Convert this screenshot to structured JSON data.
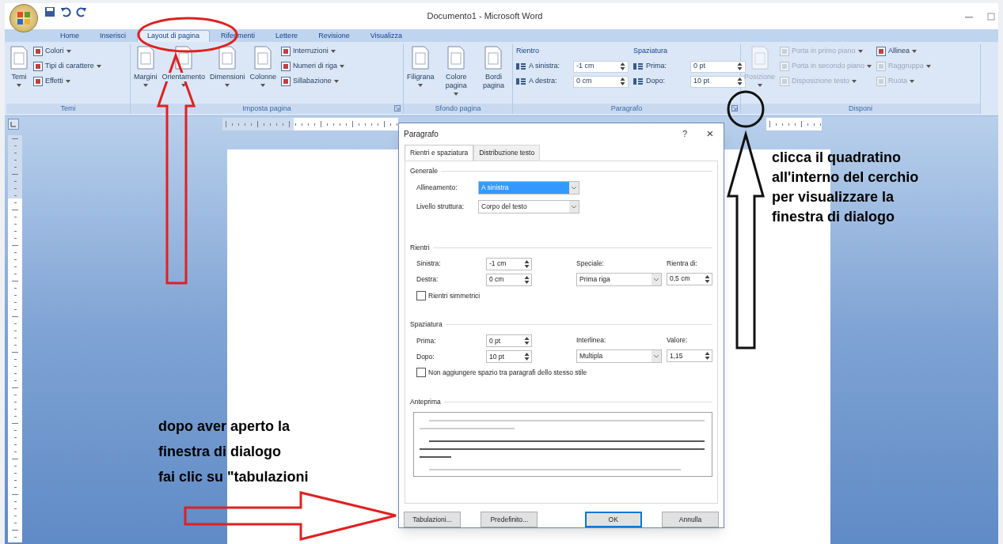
{
  "window": {
    "title": "Documento1 - Microsoft Word"
  },
  "ribbon_tabs": [
    {
      "label": "Home",
      "selected": false
    },
    {
      "label": "Inserisci",
      "selected": false
    },
    {
      "label": "Layout di pagina",
      "selected": true
    },
    {
      "label": "Riferimenti",
      "selected": false
    },
    {
      "label": "Lettere",
      "selected": false
    },
    {
      "label": "Revisione",
      "selected": false
    },
    {
      "label": "Visualizza",
      "selected": false
    }
  ],
  "ribbon_groups": [
    {
      "label": "Temi",
      "launcher": false,
      "items": [
        {
          "kind": "large",
          "label": "Temi",
          "dropdown": true,
          "disabled": false
        },
        {
          "kind": "small",
          "label": "Colori",
          "dropdown": true,
          "disabled": false
        },
        {
          "kind": "small",
          "label": "Tipi di carattere",
          "dropdown": true,
          "disabled": false
        },
        {
          "kind": "small",
          "label": "Effetti",
          "dropdown": true,
          "disabled": false
        }
      ]
    },
    {
      "label": "Imposta pagina",
      "launcher": true,
      "items": [
        {
          "kind": "large",
          "label": "Margini",
          "dropdown": true,
          "disabled": false
        },
        {
          "kind": "large",
          "label": "Orientamento",
          "dropdown": true,
          "disabled": false
        },
        {
          "kind": "large",
          "label": "Dimensioni",
          "dropdown": true,
          "disabled": false
        },
        {
          "kind": "large",
          "label": "Colonne",
          "dropdown": true,
          "disabled": false
        },
        {
          "kind": "small",
          "label": "Interruzioni",
          "dropdown": true,
          "disabled": false
        },
        {
          "kind": "small",
          "label": "Numeri di riga",
          "dropdown": true,
          "disabled": false
        },
        {
          "kind": "small",
          "label": "Sillabazione",
          "dropdown": true,
          "disabled": false
        }
      ]
    },
    {
      "label": "Sfondo pagina",
      "launcher": false,
      "items": [
        {
          "kind": "large",
          "label": "Filigrana",
          "dropdown": true,
          "disabled": false
        },
        {
          "kind": "large",
          "label": "Colore pagina",
          "dropdown": true,
          "disabled": false
        },
        {
          "kind": "large",
          "label": "Bordi pagina",
          "dropdown": false,
          "disabled": false
        }
      ]
    },
    {
      "label": "Paragrafo",
      "launcher": true,
      "items": [
        {
          "kind": "heading",
          "label": "Rientro"
        },
        {
          "kind": "spinner",
          "label": "A sinistra:",
          "value": "-1 cm"
        },
        {
          "kind": "spinner",
          "label": "A destra:",
          "value": "0 cm"
        },
        {
          "kind": "heading",
          "label": "Spaziatura"
        },
        {
          "kind": "spinner",
          "label": "Prima:",
          "value": "0 pt"
        },
        {
          "kind": "spinner",
          "label": "Dopo:",
          "value": "10 pt"
        }
      ]
    },
    {
      "label": "Disponi",
      "launcher": false,
      "items": [
        {
          "kind": "large",
          "label": "Posizione",
          "dropdown": true,
          "disabled": true
        },
        {
          "kind": "small",
          "label": "Porta in primo piano",
          "dropdown": true,
          "disabled": true
        },
        {
          "kind": "small",
          "label": "Porta in secondo piano",
          "dropdown": true,
          "disabled": true
        },
        {
          "kind": "small",
          "label": "Disposizione testo",
          "dropdown": true,
          "disabled": true
        },
        {
          "kind": "small",
          "label": "Allinea",
          "dropdown": true,
          "disabled": false
        },
        {
          "kind": "small",
          "label": "Raggruppa",
          "dropdown": true,
          "disabled": true
        },
        {
          "kind": "small",
          "label": "Ruota",
          "dropdown": true,
          "disabled": true
        }
      ]
    }
  ],
  "dialog": {
    "title": "Paragrafo",
    "help": "?",
    "close": "×",
    "tabs": [
      {
        "label": "Rientri e spaziatura",
        "selected": true
      },
      {
        "label": "Distribuzione testo",
        "selected": false
      }
    ],
    "sections": [
      {
        "kind": "list",
        "title": "Generale",
        "fields": [
          {
            "label": "Allineamento:",
            "value": "A sinistra",
            "highlighted": true
          },
          {
            "label": "Livello struttura:",
            "value": "Corpo del testo",
            "highlighted": false
          }
        ]
      },
      {
        "kind": "grid",
        "title": "Rientri",
        "spinners": [
          {
            "label": "Sinistra:",
            "value": "-1 cm"
          },
          {
            "label": "Destra:",
            "value": "0 cm"
          }
        ],
        "dropdown": {
          "label": "Speciale:",
          "value": "Prima riga"
        },
        "spinner": {
          "label": "Rientra di:",
          "value": "0,5 cm"
        },
        "checkbox": {
          "label": "Rientri simmetrici",
          "checked": false
        }
      },
      {
        "kind": "grid",
        "title": "Spaziatura",
        "spinners": [
          {
            "label": "Prima:",
            "value": "0 pt"
          },
          {
            "label": "Dopo:",
            "value": "10 pt"
          }
        ],
        "dropdown": {
          "label": "Interlinea:",
          "value": "Multipla"
        },
        "spinner": {
          "label": "Valore:",
          "value": "1,15"
        },
        "checkbox": {
          "label": "Non aggiungere spazio tra paragrafi dello stesso stile",
          "checked": false
        }
      }
    ],
    "preview_title": "Anteprima",
    "buttons": [
      {
        "label": "Tabulazioni...",
        "default": false
      },
      {
        "label": "Predefinito...",
        "default": false
      },
      {
        "label": "OK",
        "default": true
      },
      {
        "label": "Annulla",
        "default": false
      }
    ]
  },
  "notes": [
    {
      "text": "clicca il quadratino\nall'interno del cerchio\nper visualizzare la\nfinestra di dialogo"
    },
    {
      "text": "dopo aver aperto la\nfinestra di dialogo\nfai clic su \"tabulazioni"
    }
  ]
}
